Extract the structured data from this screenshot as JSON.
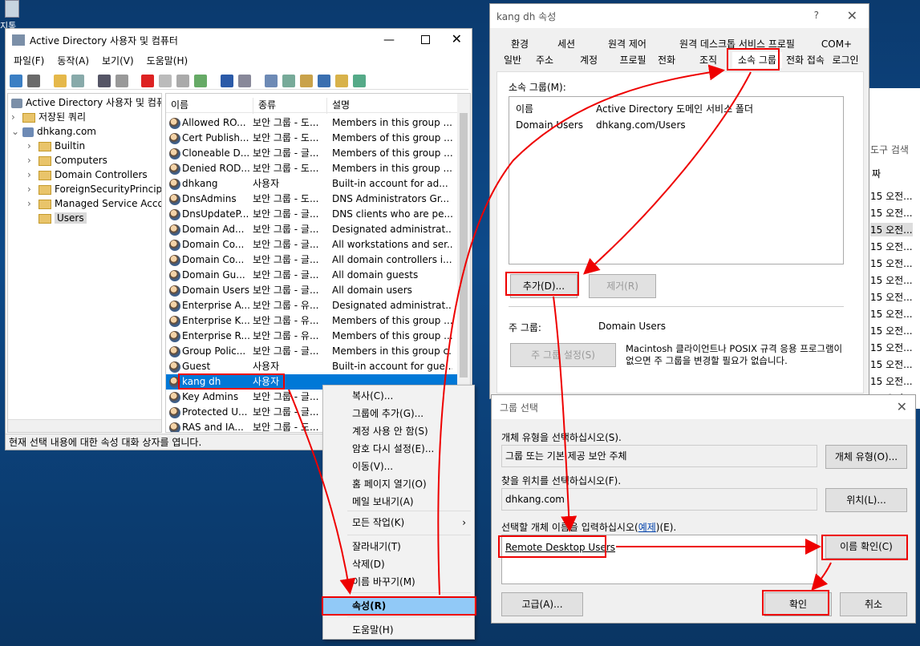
{
  "desktop": {
    "icon_label": "지통"
  },
  "ad": {
    "title": "Active Directory 사용자 및 컴퓨터",
    "menu": [
      "파일(F)",
      "동작(A)",
      "보기(V)",
      "도움말(H)"
    ],
    "tree": [
      "Active Directory 사용자 및 컴퓨",
      "저장된 쿼리",
      "dhkang.com",
      "Builtin",
      "Computers",
      "Domain Controllers",
      "ForeignSecurityPrincipa",
      "Managed Service Acco",
      "Users"
    ],
    "columns": [
      "이름",
      "종류",
      "설명"
    ],
    "rows": [
      [
        "Allowed RO...",
        "보안 그룹 - 도...",
        "Members in this group ..."
      ],
      [
        "Cert Publish...",
        "보안 그룹 - 도...",
        "Members of this group ..."
      ],
      [
        "Cloneable D...",
        "보안 그룹 - 글...",
        "Members of this group ..."
      ],
      [
        "Denied ROD...",
        "보안 그룹 - 도...",
        "Members in this group ..."
      ],
      [
        "dhkang",
        "사용자",
        "Built-in account for ad..."
      ],
      [
        "DnsAdmins",
        "보안 그룹 - 도...",
        "DNS Administrators Gr..."
      ],
      [
        "DnsUpdateP...",
        "보안 그룹 - 글...",
        "DNS clients who are pe..."
      ],
      [
        "Domain Ad...",
        "보안 그룹 - 글...",
        "Designated administrat..."
      ],
      [
        "Domain Co...",
        "보안 그룹 - 글...",
        "All workstations and ser..."
      ],
      [
        "Domain Co...",
        "보안 그룹 - 글...",
        "All domain controllers i..."
      ],
      [
        "Domain Gu...",
        "보안 그룹 - 글...",
        "All domain guests"
      ],
      [
        "Domain Users",
        "보안 그룹 - 글...",
        "All domain users"
      ],
      [
        "Enterprise A...",
        "보안 그룹 - 유...",
        "Designated administrat..."
      ],
      [
        "Enterprise K...",
        "보안 그룹 - 유...",
        "Members of this group ..."
      ],
      [
        "Enterprise R...",
        "보안 그룹 - 유...",
        "Members of this group ..."
      ],
      [
        "Group Polic...",
        "보안 그룹 - 글...",
        "Members in this group c..."
      ],
      [
        "Guest",
        "사용자",
        "Built-in account for gue..."
      ],
      [
        "kang dh",
        "사용자",
        ""
      ],
      [
        "Key Admins",
        "보안 그룹 - 글...",
        ""
      ],
      [
        "Protected U...",
        "보안 그룹 - 글...",
        ""
      ],
      [
        "RAS and IA...",
        "보안 그룹 - 도...",
        ""
      ]
    ],
    "status": "현재 선택 내용에 대한 속성 대화 상자를 엽니다."
  },
  "context_menu": [
    "복사(C)...",
    "그룹에 추가(G)...",
    "계정 사용 안 함(S)",
    "암호 다시 설정(E)...",
    "이동(V)...",
    "홈 페이지 열기(O)",
    "메일 보내기(A)",
    "모든 작업(K)",
    "잘라내기(T)",
    "삭제(D)",
    "이름 바꾸기(M)",
    "속성(R)",
    "도움말(H)"
  ],
  "props": {
    "title": "kang dh 속성",
    "help": "?",
    "tabs_row1": [
      "환경",
      "세션",
      "원격 제어",
      "원격 데스크톱 서비스 프로필",
      "COM+"
    ],
    "tabs_row2": [
      "일반",
      "주소",
      "계정",
      "프로필",
      "전화",
      "조직",
      "소속 그룹",
      "전화 접속",
      "로그인"
    ],
    "member_of_label": "소속 그룹(M):",
    "list_cols": [
      "이름",
      "Active Directory 도메인 서비스 폴더"
    ],
    "list_row": [
      "Domain Users",
      "dhkang.com/Users"
    ],
    "add": "추가(D)...",
    "remove": "제거(R)",
    "primary_label": "주 그룹:",
    "primary_value": "Domain Users",
    "set_primary": "주 그룹 설정(S)",
    "note": "Macintosh 클라이언트나 POSIX 규격 응용 프로그램이 없으면 주 그룹을 변경할 필요가 없습니다."
  },
  "bg_right": {
    "search": "도구 검색",
    "col": "짜",
    "rows": [
      "15 오전...",
      "15 오전...",
      "15 오전...",
      "15 오전...",
      "15 오전...",
      "15 오전...",
      "15 오전...",
      "15 오전...",
      "15 오전...",
      "15 오전...",
      "15 오전...",
      "15 오전...",
      "15 오전...",
      "15 오전...",
      "15 오전...",
      "15 오전..."
    ]
  },
  "select": {
    "title": "그룹 선택",
    "type_label": "개체 유형을 선택하십시오(S).",
    "type_value": "그룹 또는 기본 제공 보안 주체",
    "type_btn": "개체 유형(O)...",
    "loc_label": "찾을 위치를 선택하십시오(F).",
    "loc_value": "dhkang.com",
    "loc_btn": "위치(L)...",
    "enter_label_a": "선택할 개체 이름을 입력하십시오(",
    "enter_label_link": "예제",
    "enter_label_b": ")(E).",
    "enter_value": "Remote Desktop Users",
    "check_btn": "이름 확인(C)",
    "adv_btn": "고급(A)...",
    "ok": "확인",
    "cancel": "취소"
  }
}
